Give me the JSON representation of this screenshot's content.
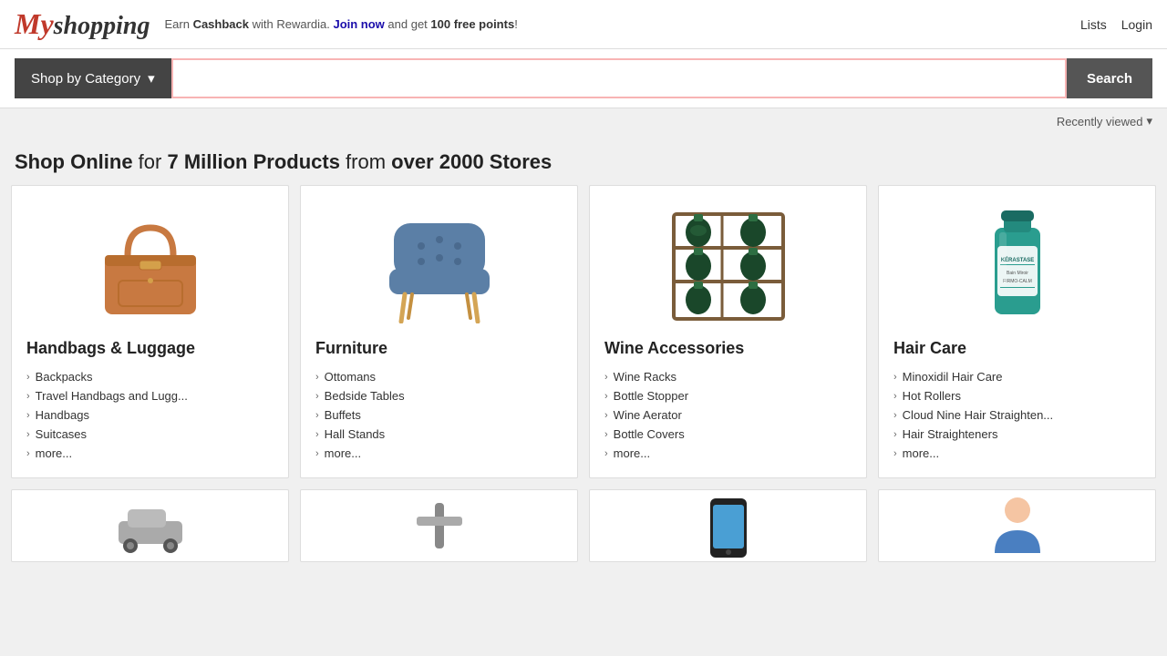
{
  "header": {
    "logo_my": "My",
    "logo_shopping": "shopping",
    "promo_prefix": "Earn ",
    "promo_bold1": "Cashback",
    "promo_mid": " with Rewardia. ",
    "promo_link": "Join now",
    "promo_suffix": " and get ",
    "promo_bold2": "100 free points",
    "promo_end": "!",
    "links": {
      "lists": "Lists",
      "login": "Login"
    }
  },
  "search": {
    "shop_by_label": "Shop by Category",
    "dropdown_arrow": "▾",
    "placeholder": "",
    "button_label": "Search"
  },
  "recently_viewed": {
    "label": "Recently viewed",
    "arrow": "▾"
  },
  "hero": {
    "text_plain1": "Shop Online",
    "text_bold1": " for ",
    "text_highlight1": "7 Million Products",
    "text_plain2": " from ",
    "text_bold2": "over 2000 Stores"
  },
  "categories": [
    {
      "id": "handbags",
      "title": "Handbags & Luggage",
      "links": [
        "Backpacks",
        "Travel Handbags and Lugg...",
        "Handbags",
        "Suitcases",
        "more..."
      ]
    },
    {
      "id": "furniture",
      "title": "Furniture",
      "links": [
        "Ottomans",
        "Bedside Tables",
        "Buffets",
        "Hall Stands",
        "more..."
      ]
    },
    {
      "id": "wine",
      "title": "Wine Accessories",
      "links": [
        "Wine Racks",
        "Bottle Stopper",
        "Wine Aerator",
        "Bottle Covers",
        "more..."
      ]
    },
    {
      "id": "haircare",
      "title": "Hair Care",
      "links": [
        "Minoxidil Hair Care",
        "Hot Rollers",
        "Cloud Nine Hair Straighten...",
        "Hair Straighteners",
        "more..."
      ]
    }
  ],
  "bottom_row_placeholders": [
    "car",
    "tool",
    "phone",
    "person"
  ]
}
